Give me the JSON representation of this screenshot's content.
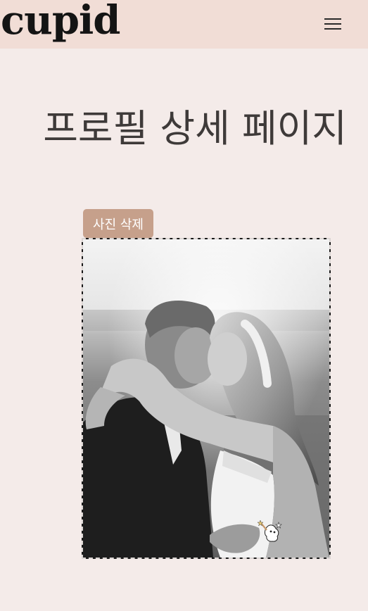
{
  "app": {
    "logo_text": "cupid",
    "menu_icon": "hamburger-menu-icon"
  },
  "main": {
    "title": "프로필 상세 페이지",
    "delete_photo_label": "사진 삭제",
    "photo": {
      "description_icon": "profile-photo",
      "style": "black-and-white"
    }
  },
  "colors": {
    "header_bg": "#f1ddd6",
    "page_bg": "#f4ebe9",
    "button_bg": "#c6a08b",
    "title_color": "#3e3a39"
  }
}
